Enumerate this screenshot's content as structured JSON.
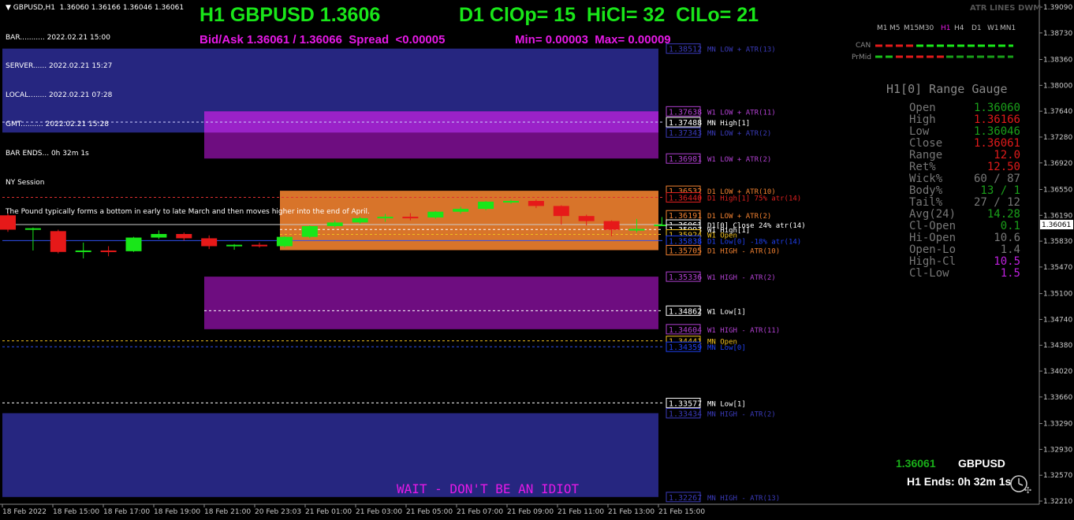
{
  "symbol_header": "GBPUSD,H1  1.36060 1.36166 1.36046 1.36061",
  "info_lines": [
    "BAR........... 2022.02.21 15:00",
    "SERVER...... 2022.02.21 15:27",
    "LOCAL........ 2022.02.21 07:28",
    "GMT.......... 2022.02.21 15:28",
    "BAR ENDS... 0h 32m 1s",
    "NY Session",
    "The Pound typically forms a bottom in early to late March and then moves higher into the end of April."
  ],
  "headline": {
    "title": "H1 GBPUSD 1.3606",
    "stats": "D1 ClOp= 15  HiCl= 32  ClLo= 21",
    "bidask": "Bid/Ask 1.36061 / 1.36066  Spread  <0.00005",
    "minmax": "Min= 0.00003  Max= 0.00009"
  },
  "indicator_name": "ATR LINES DWM",
  "timeframes": [
    "M1",
    "M5",
    "M15",
    "M30",
    "H1",
    "H4",
    "D1",
    "W1",
    "MN1"
  ],
  "active_timeframe": "H1",
  "can_label": "CAN",
  "prmid_label": "PrMid",
  "gauge": {
    "title": "H1[0] Range Gauge",
    "rows": [
      {
        "label": "Open",
        "value": "1.36060",
        "color": "#1aa01a"
      },
      {
        "label": "High",
        "value": "1.36166",
        "color": "#e01a1a"
      },
      {
        "label": "Low",
        "value": "1.36046",
        "color": "#1aa01a"
      },
      {
        "label": "Close",
        "value": "1.36061",
        "color": "#e01a1a"
      },
      {
        "label": "Range",
        "value": "12.0",
        "color": "#e01a1a"
      },
      {
        "label": "Ret%",
        "value": "12.50",
        "color": "#e01a1a"
      },
      {
        "label": "Wick%",
        "value": "60 / 87",
        "color": "#777777"
      },
      {
        "label": "Body%",
        "value": "13 / 1",
        "color": "#1aa01a"
      },
      {
        "label": "Tail%",
        "value": "27 / 12",
        "color": "#777777"
      },
      {
        "label": "Avg(24)",
        "value": "14.28",
        "color": "#1aa01a"
      },
      {
        "label": "Cl-Open",
        "value": "0.1",
        "color": "#1aa01a"
      },
      {
        "label": "Hi-Open",
        "value": "10.6",
        "color": "#777777"
      },
      {
        "label": "Open-Lo",
        "value": "1.4",
        "color": "#777777"
      },
      {
        "label": "High-Cl",
        "value": "10.5",
        "color": "#c020e0"
      },
      {
        "label": "Cl-Low",
        "value": "1.5",
        "color": "#c020e0"
      }
    ]
  },
  "bottom_price": "1.36061",
  "bottom_symbol": "GBPUSD",
  "bar_ends": "H1 Ends: 0h 32m 1s",
  "warning": "WAIT - DON'T BE AN IDIOT",
  "price_axis": {
    "labels": [
      "1.39090",
      "1.38730",
      "1.38360",
      "1.38000",
      "1.37640",
      "1.37280",
      "1.36920",
      "1.36550",
      "1.36190",
      "1.35830",
      "1.35470",
      "1.35100",
      "1.34740",
      "1.34380",
      "1.34020",
      "1.33660",
      "1.33290",
      "1.32930",
      "1.32570",
      "1.32210"
    ],
    "current": "1.36061"
  },
  "time_axis": {
    "labels": [
      "18 Feb 2022",
      "18 Feb 15:00",
      "18 Feb 17:00",
      "18 Feb 19:00",
      "18 Feb 21:00",
      "20 Feb 23:03",
      "21 Feb 01:00",
      "21 Feb 03:00",
      "21 Feb 05:00",
      "21 Feb 07:00",
      "21 Feb 09:00",
      "21 Feb 11:00",
      "21 Feb 13:00",
      "21 Feb 15:00"
    ]
  },
  "levels": [
    {
      "price": "1.38512",
      "label": "MN LOW + ATR(13)",
      "color": "#3a3ab8"
    },
    {
      "price": "1.37638",
      "label": "W1 LOW + ATR(11)",
      "color": "#b040d0"
    },
    {
      "price": "1.37488",
      "label": "MN High[1]",
      "color": "#ffffff"
    },
    {
      "price": "1.37343",
      "label": "MN LOW + ATR(2)",
      "color": "#3a3ab8"
    },
    {
      "price": "1.36981",
      "label": "W1 LOW + ATR(2)",
      "color": "#b040d0"
    },
    {
      "price": "1.36532",
      "label": "D1 LOW + ATR(10)",
      "color": "#f08030"
    },
    {
      "price": "1.36440",
      "label": "D1 High[1]  75% atr(14)",
      "color": "#e02020"
    },
    {
      "price": "1.36191",
      "label": "D1 LOW + ATR(2)",
      "color": "#f08030"
    },
    {
      "price": "1.36061",
      "label": "D1[0] Close  24% atr(14)",
      "color": "#ffffff"
    },
    {
      "price": "1.35993",
      "label": "W1 High[1]",
      "color": "#ffffff"
    },
    {
      "price": "1.35924",
      "label": "W1 Open",
      "color": "#f0c020"
    },
    {
      "price": "1.35838",
      "label": "D1 Low[0]  -18% atr(14)",
      "color": "#2040f0"
    },
    {
      "price": "1.35705",
      "label": "D1 HIGH - ATR(10)",
      "color": "#f08030"
    },
    {
      "price": "1.35336",
      "label": "W1 HIGH - ATR(2)",
      "color": "#b040d0"
    },
    {
      "price": "1.34862",
      "label": "W1 Low[1]",
      "color": "#ffffff"
    },
    {
      "price": "1.34604",
      "label": "W1 HIGH - ATR(11)",
      "color": "#b040d0"
    },
    {
      "price": "1.34441",
      "label": "MN Open",
      "color": "#f0c020"
    },
    {
      "price": "1.34359",
      "label": "MN Low[0]",
      "color": "#2040f0"
    },
    {
      "price": "1.33577",
      "label": "MN Low[1]",
      "color": "#ffffff"
    },
    {
      "price": "1.33434",
      "label": "MN HIGH - ATR(2)",
      "color": "#3a3ab8"
    },
    {
      "price": "1.32267",
      "label": "MN HIGH - ATR(13)",
      "color": "#3a3ab8"
    }
  ],
  "candles": [
    {
      "o": 1.3619,
      "h": 1.3622,
      "l": 1.3596,
      "c": 1.3599
    },
    {
      "o": 1.3599,
      "h": 1.3602,
      "l": 1.357,
      "c": 1.3601
    },
    {
      "o": 1.3597,
      "h": 1.3599,
      "l": 1.3566,
      "c": 1.3568
    },
    {
      "o": 1.3569,
      "h": 1.3581,
      "l": 1.3559,
      "c": 1.357
    },
    {
      "o": 1.357,
      "h": 1.3576,
      "l": 1.3562,
      "c": 1.3568
    },
    {
      "o": 1.3569,
      "h": 1.3589,
      "l": 1.3568,
      "c": 1.3588
    },
    {
      "o": 1.3588,
      "h": 1.3598,
      "l": 1.3586,
      "c": 1.3593
    },
    {
      "o": 1.3593,
      "h": 1.3595,
      "l": 1.3584,
      "c": 1.3587
    },
    {
      "o": 1.3587,
      "h": 1.3591,
      "l": 1.3572,
      "c": 1.3576
    },
    {
      "o": 1.3576,
      "h": 1.3579,
      "l": 1.3571,
      "c": 1.3578
    },
    {
      "o": 1.3578,
      "h": 1.3581,
      "l": 1.3574,
      "c": 1.3576
    },
    {
      "o": 1.3576,
      "h": 1.359,
      "l": 1.3574,
      "c": 1.3589
    },
    {
      "o": 1.3589,
      "h": 1.3605,
      "l": 1.3587,
      "c": 1.3604
    },
    {
      "o": 1.3604,
      "h": 1.3612,
      "l": 1.3602,
      "c": 1.3609
    },
    {
      "o": 1.3609,
      "h": 1.3617,
      "l": 1.3607,
      "c": 1.3615
    },
    {
      "o": 1.3615,
      "h": 1.3621,
      "l": 1.361,
      "c": 1.3617
    },
    {
      "o": 1.3617,
      "h": 1.3622,
      "l": 1.3612,
      "c": 1.3616
    },
    {
      "o": 1.3616,
      "h": 1.3625,
      "l": 1.3614,
      "c": 1.3624
    },
    {
      "o": 1.3624,
      "h": 1.3631,
      "l": 1.3621,
      "c": 1.3628
    },
    {
      "o": 1.3628,
      "h": 1.3639,
      "l": 1.3626,
      "c": 1.3638
    },
    {
      "o": 1.3638,
      "h": 1.3641,
      "l": 1.3635,
      "c": 1.3639
    },
    {
      "o": 1.3639,
      "h": 1.3641,
      "l": 1.3629,
      "c": 1.3632
    },
    {
      "o": 1.3632,
      "h": 1.3633,
      "l": 1.3606,
      "c": 1.3618
    },
    {
      "o": 1.3618,
      "h": 1.362,
      "l": 1.3605,
      "c": 1.3611
    },
    {
      "o": 1.3611,
      "h": 1.3612,
      "l": 1.359,
      "c": 1.3599
    },
    {
      "o": 1.3599,
      "h": 1.3614,
      "l": 1.3595,
      "c": 1.36
    },
    {
      "o": 1.3606,
      "h": 1.36166,
      "l": 1.36046,
      "c": 1.36061
    }
  ]
}
